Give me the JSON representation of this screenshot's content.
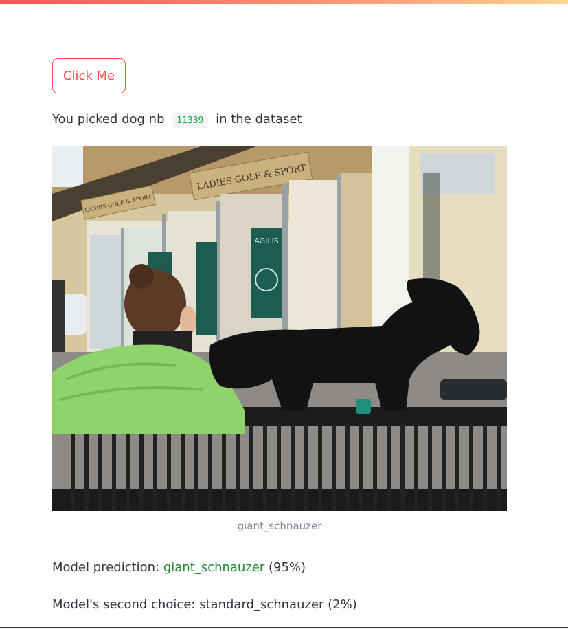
{
  "button": {
    "label": "Click Me"
  },
  "picked": {
    "prefix": "You picked dog nb",
    "dog_number": "11339",
    "suffix": "in the dataset"
  },
  "image": {
    "caption": "giant_schnauzer",
    "storefront_sign": "LADIES GOLF & SPORT",
    "window_poster": "AGILIS"
  },
  "prediction": {
    "label": "Model prediction:",
    "class": "giant_schnauzer",
    "confidence": "(95%)"
  },
  "second_choice": {
    "label": "Model's second choice:",
    "class": "standard_schnauzer",
    "confidence": "(2%)"
  },
  "colors": {
    "accent": "#ff4b4b",
    "prediction_green": "#21872f",
    "code_green": "#09ab3b",
    "text": "#31333f",
    "caption": "#808495"
  }
}
